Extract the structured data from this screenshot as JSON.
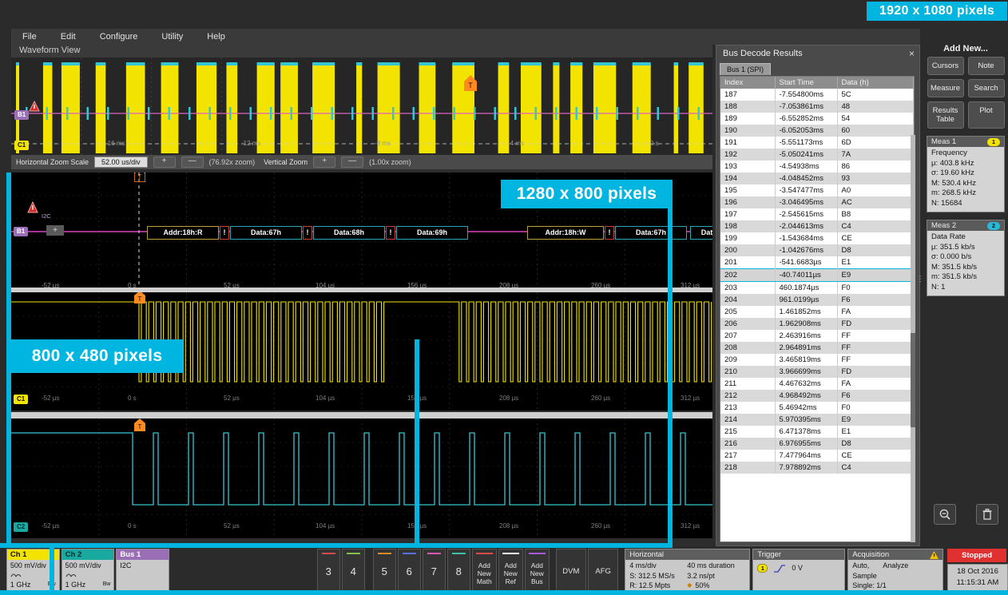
{
  "overlays": {
    "res_1920": "1920 x 1080 pixels",
    "res_1280": "1280 x 800 pixels",
    "res_800": "800 x 480 pixels",
    "accent": "#00b6e0"
  },
  "menubar": {
    "items": [
      "File",
      "Edit",
      "Configure",
      "Utility",
      "Help"
    ]
  },
  "waveform_view": {
    "title": "Waveform View",
    "overview_badge_ch1": "C1",
    "overview_badge_bus": "B1",
    "overview_times": [
      "-16 ms",
      "-12 ms",
      "-8 ms",
      "-4 ms",
      "0 s"
    ],
    "zoom_toolbar": {
      "h_label": "Horizontal Zoom Scale",
      "h_value": "52.00 us/div",
      "plus": "+",
      "minus": "—",
      "h_factor": "(76.92x zoom)",
      "v_label": "Vertical Zoom",
      "v_factor": "(1.00x zoom)"
    },
    "bus_label": "I2C",
    "bus_badge": "B1",
    "packets": [
      {
        "type": "addr",
        "text": "Addr:18h:R"
      },
      {
        "type": "err",
        "text": "!"
      },
      {
        "type": "data",
        "text": "Data:67h"
      },
      {
        "type": "err",
        "text": "!"
      },
      {
        "type": "data",
        "text": "Data:68h"
      },
      {
        "type": "err",
        "text": "!"
      },
      {
        "type": "data",
        "text": "Data:69h"
      },
      {
        "type": "addr",
        "text": "Addr:18h:W"
      },
      {
        "type": "err",
        "text": "!"
      },
      {
        "type": "data",
        "text": "Data:67h"
      },
      {
        "type": "data",
        "text": "Data:"
      }
    ],
    "time_ticks": [
      "-52 µs",
      "0 s",
      "52 µs",
      "104 µs",
      "156 µs",
      "208 µs",
      "260 µs",
      "312 µs"
    ],
    "pane2_badge": "C1",
    "pane3_badge": "C2",
    "trigger_marker": "T"
  },
  "bus_decode": {
    "title": "Bus Decode Results",
    "close_icon": "×",
    "tab": "Bus 1 (SPI)",
    "columns": [
      "Index",
      "Start Time",
      "Data (h)"
    ],
    "selected_index": "202",
    "rows": [
      {
        "index": "187",
        "time": "-7.554800ms",
        "data": "5C",
        "clipped": true
      },
      {
        "index": "188",
        "time": "-7.053861ms",
        "data": "48"
      },
      {
        "index": "189",
        "time": "-6.552852ms",
        "data": "54"
      },
      {
        "index": "190",
        "time": "-6.052053ms",
        "data": "60"
      },
      {
        "index": "191",
        "time": "-5.551173ms",
        "data": "6D"
      },
      {
        "index": "192",
        "time": "-5.050241ms",
        "data": "7A"
      },
      {
        "index": "193",
        "time": "-4.54938ms",
        "data": "86"
      },
      {
        "index": "194",
        "time": "-4.048452ms",
        "data": "93"
      },
      {
        "index": "195",
        "time": "-3.547477ms",
        "data": "A0"
      },
      {
        "index": "196",
        "time": "-3.046495ms",
        "data": "AC"
      },
      {
        "index": "197",
        "time": "-2.545615ms",
        "data": "B8"
      },
      {
        "index": "198",
        "time": "-2.044613ms",
        "data": "C4"
      },
      {
        "index": "199",
        "time": "-1.543684ms",
        "data": "CE"
      },
      {
        "index": "200",
        "time": "-1.042676ms",
        "data": "D8"
      },
      {
        "index": "201",
        "time": "-541.6683µs",
        "data": "E1"
      },
      {
        "index": "202",
        "time": "-40.74011µs",
        "data": "E9",
        "selected": true
      },
      {
        "index": "203",
        "time": "460.1874µs",
        "data": "F0"
      },
      {
        "index": "204",
        "time": "961.0199µs",
        "data": "F6"
      },
      {
        "index": "205",
        "time": "1.461852ms",
        "data": "FA"
      },
      {
        "index": "206",
        "time": "1.962908ms",
        "data": "FD"
      },
      {
        "index": "207",
        "time": "2.463916ms",
        "data": "FF"
      },
      {
        "index": "208",
        "time": "2.964891ms",
        "data": "FF"
      },
      {
        "index": "209",
        "time": "3.465819ms",
        "data": "FF"
      },
      {
        "index": "210",
        "time": "3.966699ms",
        "data": "FD"
      },
      {
        "index": "211",
        "time": "4.467632ms",
        "data": "FA"
      },
      {
        "index": "212",
        "time": "4.968492ms",
        "data": "F6"
      },
      {
        "index": "213",
        "time": "5.46942ms",
        "data": "F0"
      },
      {
        "index": "214",
        "time": "5.970395ms",
        "data": "E9"
      },
      {
        "index": "215",
        "time": "6.471378ms",
        "data": "E1"
      },
      {
        "index": "216",
        "time": "6.976955ms",
        "data": "D8"
      },
      {
        "index": "217",
        "time": "7.477964ms",
        "data": "CE"
      },
      {
        "index": "218",
        "time": "7.978892ms",
        "data": "C4",
        "clipped": true
      }
    ]
  },
  "sidebar": {
    "add_new": "Add New...",
    "buttons": [
      "Cursors",
      "Note",
      "Measure",
      "Search",
      "Results Table",
      "Plot"
    ],
    "measurements": [
      {
        "header": "Meas 1",
        "chip": "1",
        "chip_color": "#f2e400",
        "name": "Frequency",
        "stats": [
          "μ: 403.8 kHz",
          "σ: 19.60 kHz",
          "M: 530.4 kHz",
          "m: 268.5 kHz",
          "N: 15684"
        ]
      },
      {
        "header": "Meas 2",
        "chip": "2",
        "chip_color": "#2ab8d8",
        "name": "Data Rate",
        "stats": [
          "μ: 351.5 kb/s",
          "σ: 0.000 b/s",
          "M: 351.5 kb/s",
          "m: 351.5 kb/s",
          "N: 1"
        ]
      }
    ],
    "tools": [
      "zoom-out-icon",
      "trash-icon"
    ]
  },
  "bottom_bar": {
    "channels": [
      {
        "name": "Ch 1",
        "color": "#f2e400",
        "scale": "500 mV/div",
        "bw": "1 GHz",
        "bw_icon": "Bᴡ"
      },
      {
        "name": "Ch 2",
        "color": "#1aa9a0",
        "scale": "500 mV/div",
        "bw": "1 GHz",
        "bw_icon": "Bᴡ"
      }
    ],
    "bus": {
      "name": "Bus 1",
      "color": "#9b6fb5",
      "type": "I2C"
    },
    "num_buttons": [
      {
        "label": "3",
        "color": "#d84b4b"
      },
      {
        "label": "4",
        "color": "#7fc04a"
      },
      {
        "label": "5",
        "color": "#e08b2a"
      },
      {
        "label": "6",
        "color": "#5a6fd8"
      },
      {
        "label": "7",
        "color": "#d85ab5"
      },
      {
        "label": "8",
        "color": "#3fc0a8"
      }
    ],
    "add_buttons": [
      {
        "label": "Add New Math",
        "color": "#d84b4b"
      },
      {
        "label": "Add New Ref",
        "color": "#ffffff"
      },
      {
        "label": "Add New Bus",
        "color": "#a95ad8"
      }
    ],
    "wide_buttons": [
      "DVM",
      "AFG"
    ],
    "horizontal": {
      "title": "Horizontal",
      "scale": "4 ms/div",
      "duration": "40 ms duration",
      "sample_rate_label": "S: 312.5 MS/s",
      "resolution": "3.2 ns/pt",
      "record_label": "R: 12.5 Mpts",
      "position": "50%"
    },
    "trigger": {
      "title": "Trigger",
      "source": "1",
      "slope_icon": "rising-edge-icon",
      "level": "0 V"
    },
    "acquisition": {
      "title": "Acquisition",
      "warn_icon": "warning-icon",
      "mode": "Auto,",
      "analyze": "Analyze",
      "sample": "Sample",
      "single": "Single: 1/1"
    },
    "status": {
      "label": "Stopped",
      "color": "#e03030"
    },
    "clock": {
      "date": "18 Oct 2016",
      "time": "11:15:31 AM"
    }
  }
}
